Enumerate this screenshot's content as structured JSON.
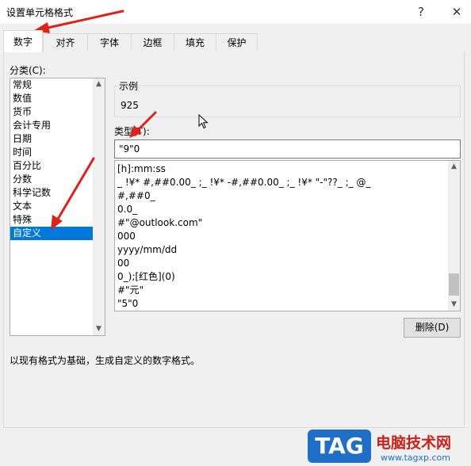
{
  "dialog": {
    "title": "设置单元格格式",
    "help_glyph": "?",
    "close_glyph": "✕"
  },
  "tabs": [
    {
      "label": "数字",
      "active": true
    },
    {
      "label": "对齐"
    },
    {
      "label": "字体"
    },
    {
      "label": "边框"
    },
    {
      "label": "填充"
    },
    {
      "label": "保护"
    }
  ],
  "category": {
    "label": "分类(C):",
    "items": [
      "常规",
      "数值",
      "货币",
      "会计专用",
      "日期",
      "时间",
      "百分比",
      "分数",
      "科学记数",
      "文本",
      "特殊",
      "自定义"
    ],
    "selected_index": 11
  },
  "sample": {
    "label": "示例",
    "value": "925"
  },
  "type": {
    "label": "类型(T):",
    "value": "\"9\"0"
  },
  "formats": [
    "[h]:mm:ss",
    "_ !¥* #,##0.00_ ;_ !¥* -#,##0.00_ ;_ !¥* \"-\"??_ ;_ @_",
    "#,##0_",
    "0.0_",
    "#\"@outlook.com\"",
    "000",
    "yyyy/mm/dd",
    "00",
    "0_);[红色](0)",
    "#\"元\"",
    "\"5\"0"
  ],
  "delete_button": "删除(D)",
  "description": "以现有格式为基础，生成自定义的数字格式。",
  "watermark": {
    "tag": "TAG",
    "site_name": "电脑技术网",
    "url": "www.tagxp.com"
  },
  "colors": {
    "selection": "#0078d7",
    "annotation_arrow": "#e0201b"
  },
  "icons": {
    "scroll_up": "chevron-up-icon",
    "scroll_down": "chevron-down-icon",
    "cursor": "mouse-pointer-icon"
  }
}
